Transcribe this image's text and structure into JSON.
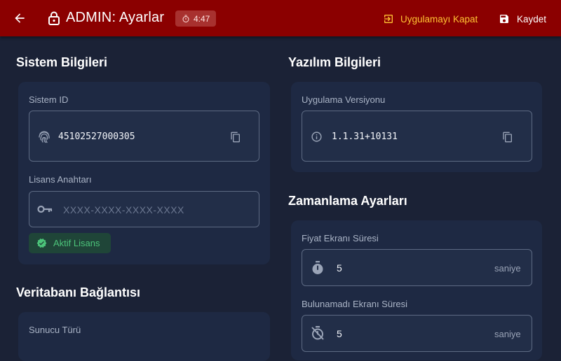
{
  "header": {
    "title": "ADMIN: Ayarlar",
    "timer": "4:47",
    "close_app_label": "Uygulamayı Kapat",
    "save_label": "Kaydet"
  },
  "system_info": {
    "section_title": "Sistem Bilgileri",
    "system_id_label": "Sistem ID",
    "system_id_value": "45102527000305",
    "license_label": "Lisans Anahtarı",
    "license_placeholder": "XXXX-XXXX-XXXX-XXXX",
    "license_status": "Aktif Lisans"
  },
  "software_info": {
    "section_title": "Yazılım Bilgileri",
    "version_label": "Uygulama Versiyonu",
    "version_value": "1.1.31+10131"
  },
  "timing": {
    "section_title": "Zamanlama Ayarları",
    "price_screen_label": "Fiyat Ekranı Süresi",
    "price_screen_value": "5",
    "not_found_label": "Bulunamadı Ekranı Süresi",
    "not_found_value": "5",
    "unit": "saniye"
  },
  "database": {
    "section_title": "Veritabanı Bağlantısı",
    "server_type_label": "Sunucu Türü"
  },
  "colors": {
    "appbar": "#8b0000",
    "background": "#1b2236",
    "card": "#1e2943",
    "accent_warning": "#ffc233",
    "license_active": "#4cc47a"
  },
  "icons": [
    "arrow-back-icon",
    "lock-icon",
    "timer-icon",
    "exit-icon",
    "save-icon",
    "fingerprint-icon",
    "copy-icon",
    "key-icon",
    "verified-icon",
    "info-icon",
    "stopwatch-icon",
    "timer-off-icon"
  ]
}
